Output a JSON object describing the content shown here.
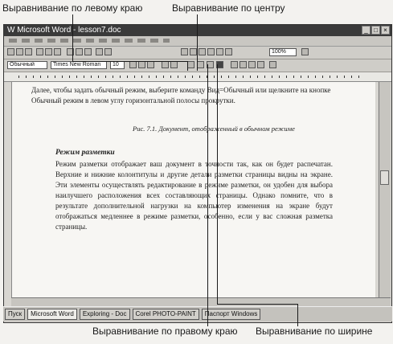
{
  "callouts": {
    "left": "Выравнивание по левому краю",
    "center": "Выравнивание по центру",
    "right": "Выравнивание по правому краю",
    "justify": "Выравнивание по ширине"
  },
  "window": {
    "title": "W Microsoft Word - lesson7.doc",
    "minimize": "_",
    "maximize": "□",
    "close": "×"
  },
  "toolbar": {
    "style": "Обычный",
    "font": "Times New Roman",
    "size": "10",
    "zoom": "100%"
  },
  "document": {
    "intro": "Далее, чтобы задать обычный режим, выберите команду Вид=Обычный или щелкните на кнопке Обычный режим в левом углу горизонтальной полосы прокрутки.",
    "caption": "Рис. 7.1. Документ, отображенный в обычном режиме",
    "heading": "Режим разметки",
    "body": "Режим разметки отображает ваш документ в точности так, как он будет распечатан. Верхние и нижние колонтитулы и другие детали разметки страницы видны на экране. Эти элементы осуществлять редактирование в режиме разметки, он удобен для выбора наилучшего расположения всех составляющих страницы. Однако помните, что в результате дополнительной нагрузки на компьютер изменения на экране будут отображаться медленнее в режиме разметки, особенно, если у вас сложная разметка страницы."
  },
  "taskbar": {
    "start": "Пуск",
    "word": "Microsoft Word",
    "app2": "Exploring - Doc",
    "app3": "Corel PHOTO-PAINT",
    "app4": "Паспорт Windows"
  }
}
